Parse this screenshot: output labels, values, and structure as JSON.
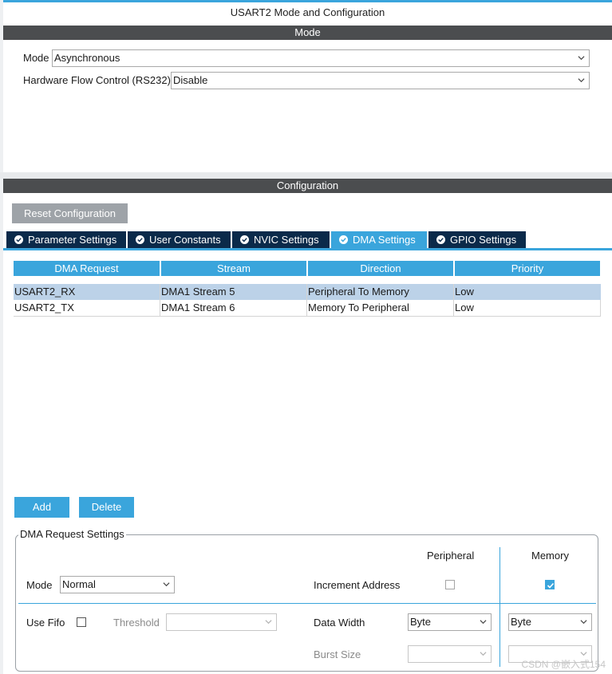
{
  "window": {
    "title": "USART2 Mode and Configuration"
  },
  "mode_section": {
    "header": "Mode",
    "mode_label": "Mode",
    "mode_value": "Asynchronous",
    "flow_label": "Hardware Flow Control (RS232)",
    "flow_value": "Disable"
  },
  "config_section": {
    "header": "Configuration",
    "reset_button": "Reset Configuration",
    "tabs": [
      {
        "label": "Parameter Settings",
        "icon": "check-circle-icon"
      },
      {
        "label": "User Constants",
        "icon": "check-circle-icon"
      },
      {
        "label": "NVIC Settings",
        "icon": "check-circle-icon"
      },
      {
        "label": "DMA Settings",
        "icon": "check-circle-icon",
        "active": true
      },
      {
        "label": "GPIO Settings",
        "icon": "check-circle-icon"
      }
    ]
  },
  "dma_table": {
    "columns": [
      "DMA Request",
      "Stream",
      "Direction",
      "Priority"
    ],
    "rows": [
      {
        "request": "USART2_RX",
        "stream": "DMA1 Stream 5",
        "direction": "Peripheral To Memory",
        "priority": "Low",
        "selected": true
      },
      {
        "request": "USART2_TX",
        "stream": "DMA1 Stream 6",
        "direction": "Memory To Peripheral",
        "priority": "Low"
      }
    ]
  },
  "actions": {
    "add": "Add",
    "delete": "Delete"
  },
  "dma_request_settings": {
    "legend": "DMA Request Settings",
    "peripheral_header": "Peripheral",
    "memory_header": "Memory",
    "mode_label": "Mode",
    "mode_value": "Normal",
    "increment_label": "Increment Address",
    "peripheral_increment": false,
    "memory_increment": true,
    "use_fifo_label": "Use Fifo",
    "use_fifo": false,
    "threshold_label": "Threshold",
    "threshold_value": "",
    "data_width_label": "Data Width",
    "peripheral_data_width": "Byte",
    "memory_data_width": "Byte",
    "burst_size_label": "Burst Size",
    "peripheral_burst": "",
    "memory_burst": ""
  },
  "watermark": "CSDN @嵌入式154",
  "colors": {
    "accent": "#3aa5dc",
    "tab_bg": "#0b2a4a",
    "section_bar": "#4b4d4f",
    "selected_row": "#bcd2e8"
  }
}
